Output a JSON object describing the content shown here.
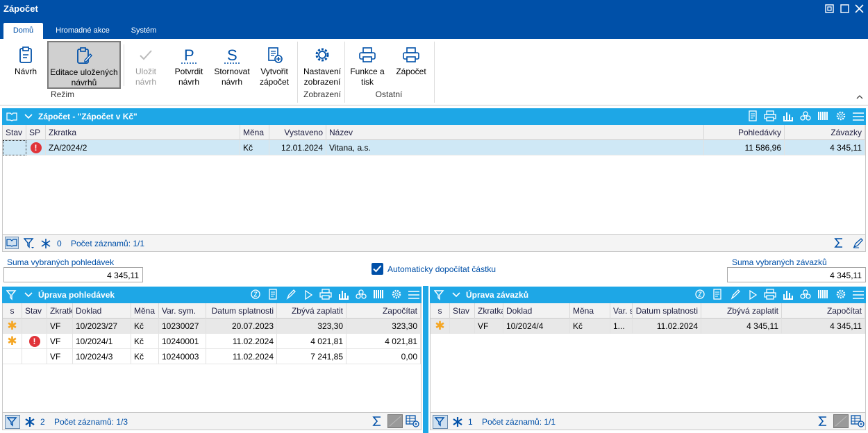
{
  "window": {
    "title": "Zápočet"
  },
  "tabs": [
    "Domů",
    "Hromadné akce",
    "Systém"
  ],
  "ribbon": {
    "navrh": "Návrh",
    "editace": "Editace uložených návrhů",
    "ulozit": "Uložit návrh",
    "potvrdit": "Potvrdit návrh",
    "stornovat": "Stornovat návrh",
    "vytvorit": "Vytvořit zápočet",
    "nastaveni": "Nastavení zobrazení",
    "funkce": "Funkce a tisk",
    "zapocet": "Zápočet",
    "groups": {
      "rezim": "Režim",
      "zobrazeni": "Zobrazení",
      "ostatni": "Ostatní"
    }
  },
  "main": {
    "title": "Zápočet - \"Zápočet v Kč\"",
    "columns": [
      "Stav",
      "SP",
      "Zkratka",
      "Měna",
      "Vystaveno",
      "Název",
      "Pohledávky",
      "Závazky"
    ],
    "rows": [
      {
        "zkratka": "ZA/2024/2",
        "mena": "Kč",
        "vystaveno": "12.01.2024",
        "nazev": "Vitana, a.s.",
        "pohledavky": "11 586,96",
        "zavazky": "4 345,11"
      }
    ],
    "filter_count": "0",
    "records": "Počet záznamů: 1/1"
  },
  "sums": {
    "pohledavek_label": "Suma vybraných pohledávek",
    "pohledavek_value": "4 345,11",
    "auto_label": "Automaticky dopočítat částku",
    "zavazku_label": "Suma vybraných závazků",
    "zavazku_value": "4 345,11"
  },
  "left": {
    "title": "Úprava pohledávek",
    "columns": [
      "s",
      "Stav",
      "Zkratka",
      "Doklad",
      "Měna",
      "Var. sym.",
      "Datum splatnosti",
      "Zbývá zaplatit",
      "Započítat"
    ],
    "rows": [
      {
        "zkratka": "VF",
        "doklad": "10/2023/27",
        "mena": "Kč",
        "varsym": "10230027",
        "datum": "20.07.2023",
        "zbyva": "323,30",
        "zapocitat": "323,30"
      },
      {
        "zkratka": "VF",
        "doklad": "10/2024/1",
        "mena": "Kč",
        "varsym": "10240001",
        "datum": "11.02.2024",
        "zbyva": "4 021,81",
        "zapocitat": "4 021,81"
      },
      {
        "zkratka": "VF",
        "doklad": "10/2024/3",
        "mena": "Kč",
        "varsym": "10240003",
        "datum": "11.02.2024",
        "zbyva": "7 241,85",
        "zapocitat": "0,00"
      }
    ],
    "filter_count": "2",
    "records": "Počet záznamů: 1/3"
  },
  "right": {
    "title": "Úprava závazků",
    "columns": [
      "s",
      "Stav",
      "Zkratka",
      "Doklad",
      "Měna",
      "Var. sym.",
      "Datum splatnosti",
      "Zbývá zaplatit",
      "Započítat"
    ],
    "rows": [
      {
        "zkratka": "VF",
        "doklad": "10/2024/4",
        "mena": "Kč",
        "varsym": "1...",
        "datum": "11.02.2024",
        "zbyva": "4 345,11",
        "zapocitat": "4 345,11"
      }
    ],
    "filter_count": "1",
    "records": "Počet záznamů: 1/1"
  },
  "colors": {
    "titlebar": "#0050a8",
    "panel_header": "#1ea7e6",
    "selected_row": "#cfe8f6",
    "alert": "#e0343a",
    "star": "#f5a623"
  }
}
